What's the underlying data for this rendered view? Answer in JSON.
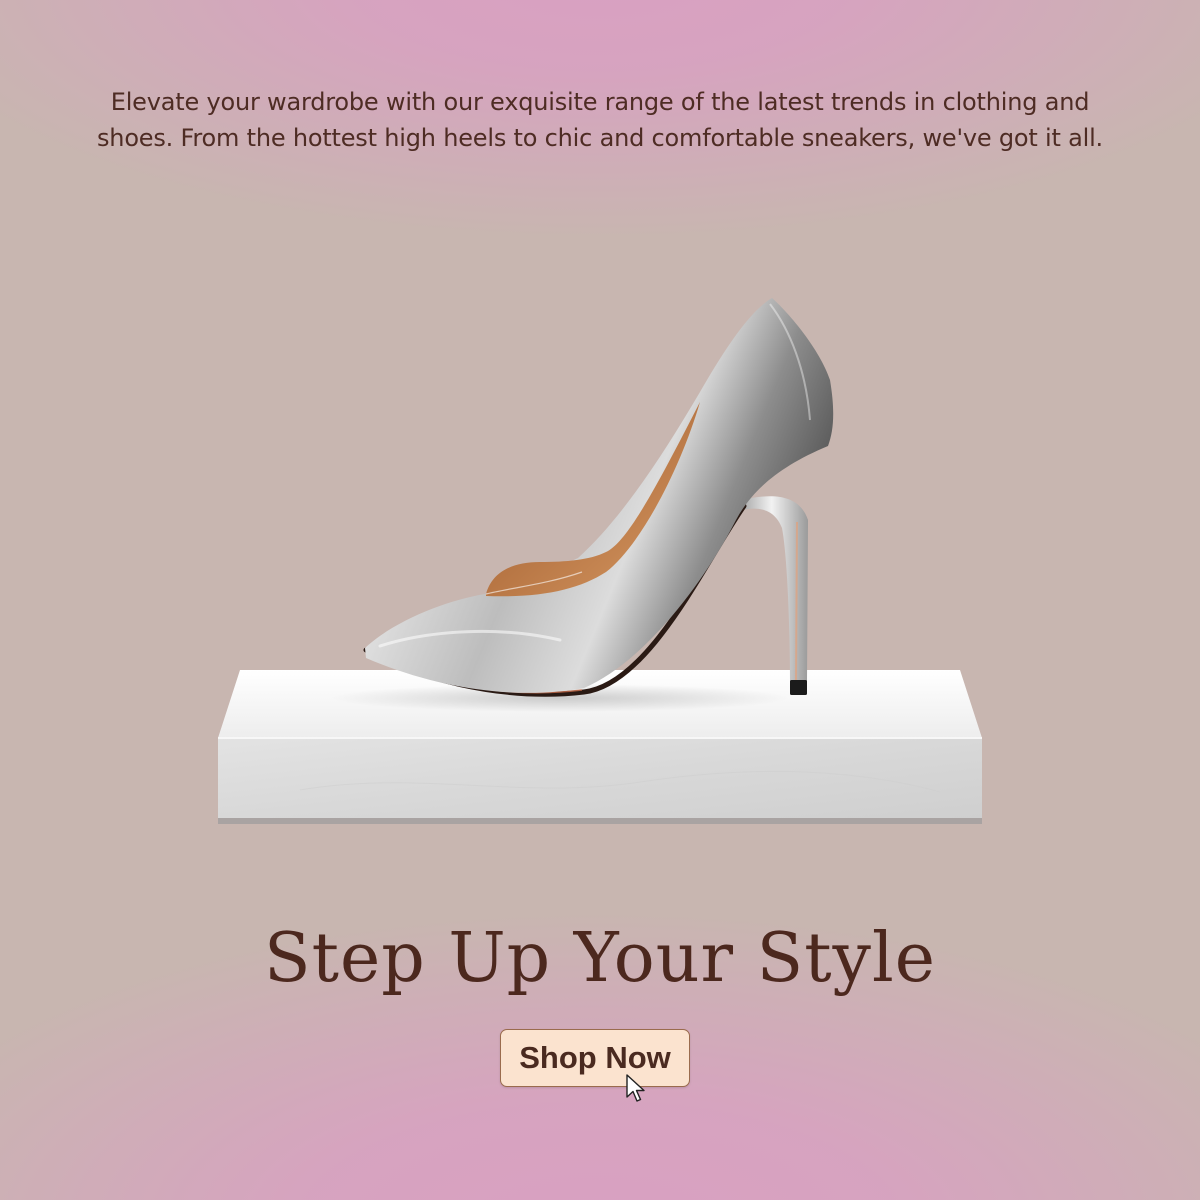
{
  "intro": {
    "line1": "Elevate your wardrobe with our exquisite range of the latest trends in clothing and",
    "line2": "shoes. From the hottest high heels to chic and comfortable sneakers, we've got it all."
  },
  "headline": "Step Up Your Style",
  "cta": {
    "label": "Shop Now"
  },
  "colors": {
    "background": "#c8b6b0",
    "glow": "#d9a0c2",
    "text": "#4c281e",
    "button_bg": "#fbe3cf",
    "button_border": "#9a6b4d"
  },
  "icons": {
    "cursor": "mouse-pointer-icon"
  }
}
